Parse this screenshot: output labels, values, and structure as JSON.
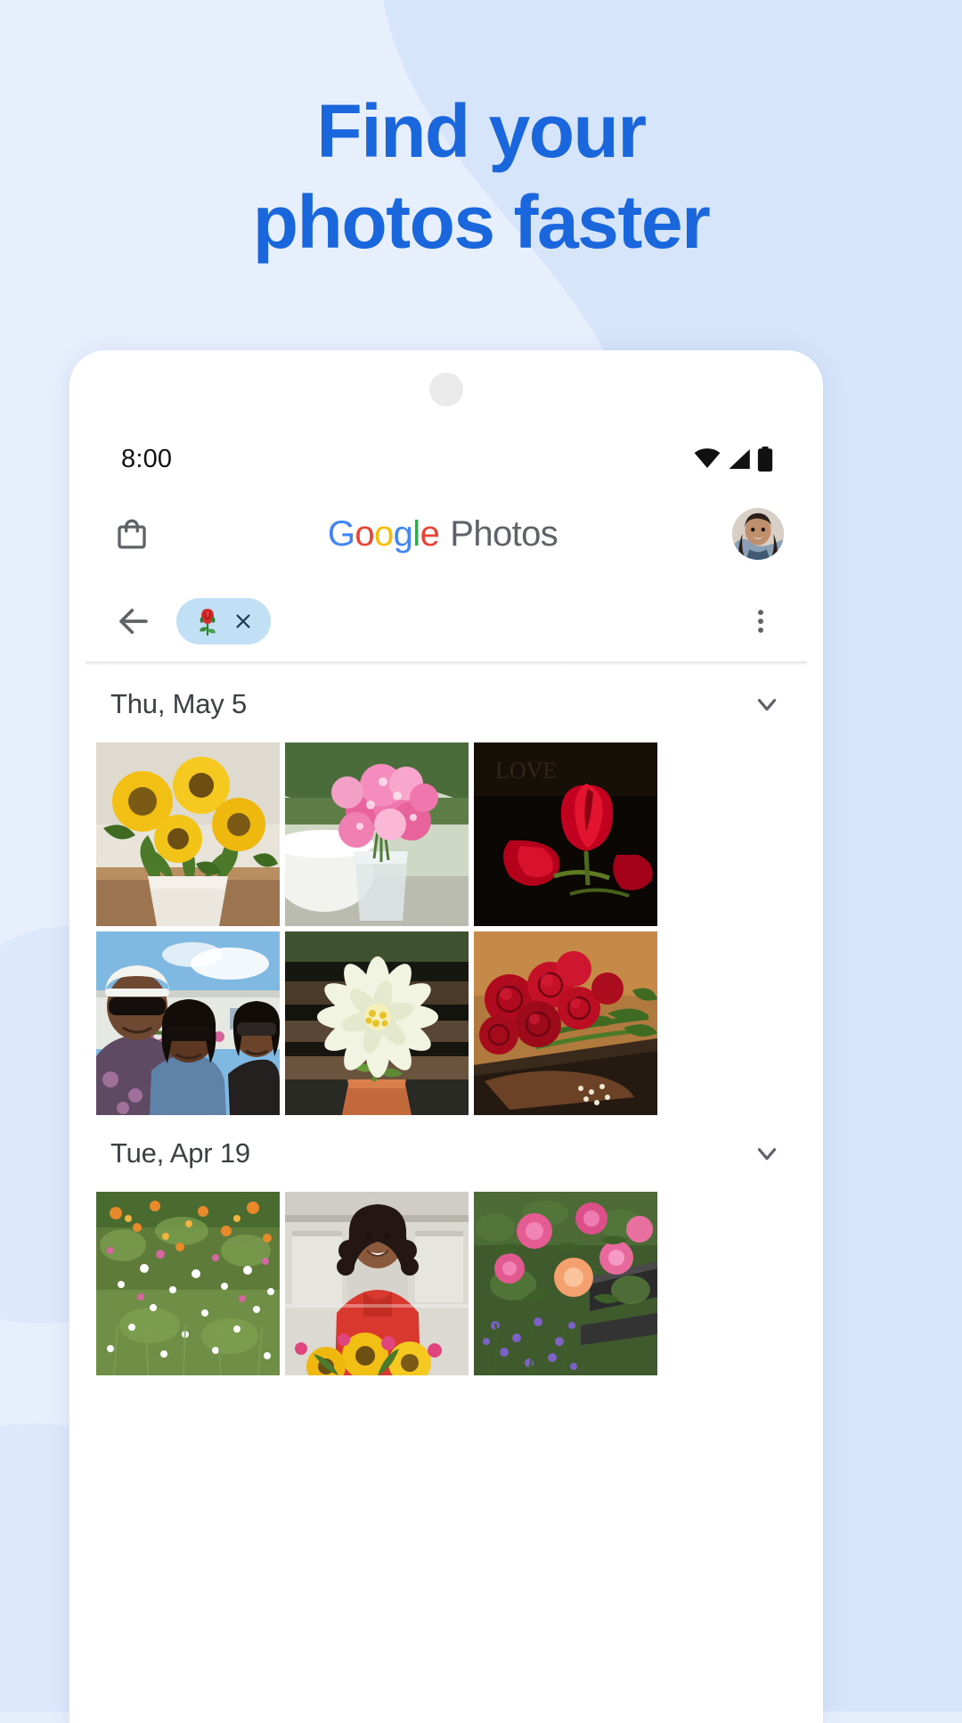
{
  "promo": {
    "headline_line_1": "Find your",
    "headline_line_2": "photos faster",
    "headline_color": "#1a66dd",
    "background_color": "#e6eefc"
  },
  "phone": {
    "status_bar": {
      "time": "8:00",
      "icons": [
        "wifi-icon",
        "signal-icon",
        "battery-icon"
      ]
    },
    "app_header": {
      "store_icon": "shopping-bag-icon",
      "brand_google": "Google",
      "brand_product": "Photos",
      "google_letters": [
        {
          "char": "G",
          "color": "#4285F4"
        },
        {
          "char": "o",
          "color": "#EA4335"
        },
        {
          "char": "o",
          "color": "#FBBC05"
        },
        {
          "char": "g",
          "color": "#4285F4"
        },
        {
          "char": "l",
          "color": "#34A853"
        },
        {
          "char": "e",
          "color": "#EA4335"
        }
      ],
      "product_color": "#5f6368",
      "avatar": "user-avatar"
    },
    "search_bar": {
      "back_icon": "back-arrow-icon",
      "chip_emoji": "rose-emoji",
      "chip_emoji_char": "🌹",
      "chip_close_icon": "close-icon",
      "chip_background": "#c2e0f5",
      "overflow_icon": "more-vert-icon"
    },
    "sections": [
      {
        "date": "Thu, May 5",
        "chevron": "chevron-down-icon",
        "rows": [
          [
            "sunflowers-in-vase",
            "pink-flowers-in-jar",
            "red-tulips-dark"
          ],
          [
            "three-friends-selfie",
            "white-zinnia-flower",
            "red-roses-on-table"
          ]
        ]
      },
      {
        "date": "Tue, Apr 19",
        "chevron": "chevron-down-icon",
        "rows": [
          [
            "wildflower-meadow",
            "woman-with-sunflowers",
            "pink-roses-on-fence"
          ]
        ]
      }
    ]
  }
}
